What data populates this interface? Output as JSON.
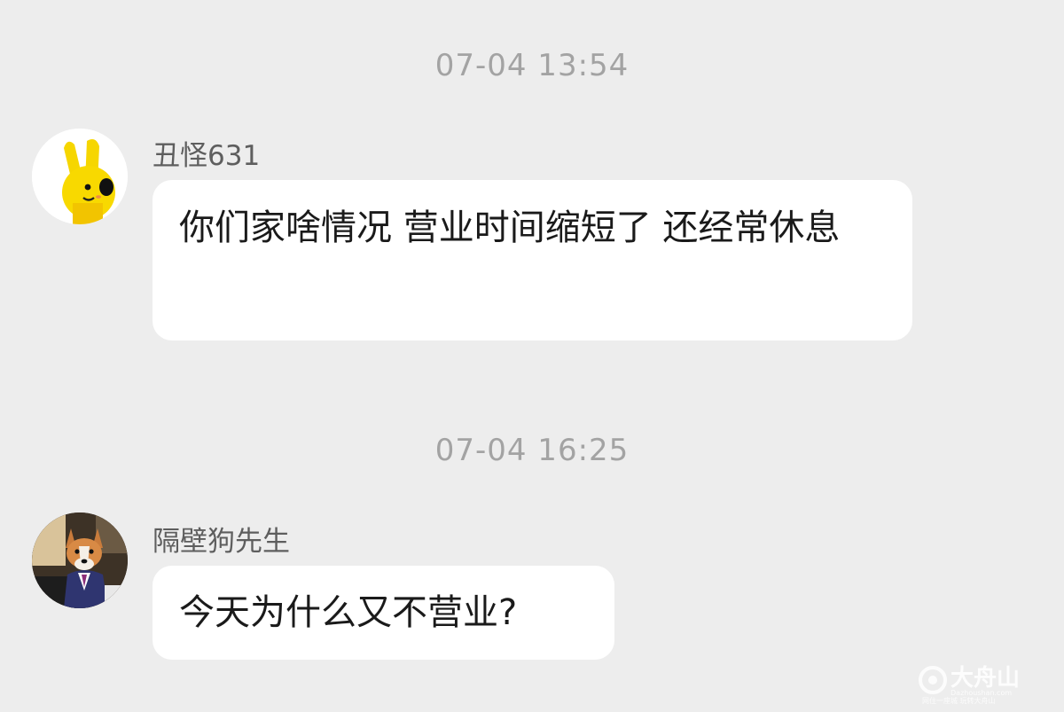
{
  "messages": [
    {
      "timestamp": "07-04 13:54",
      "sender": "丑怪631",
      "avatar": "yellow-hand-mascot-avatar",
      "text": "你们家啥情况 营业时间缩短了 还经常休息"
    },
    {
      "timestamp": "07-04 16:25",
      "sender": "隔壁狗先生",
      "avatar": "corgi-in-suit-avatar",
      "text": "今天为什么又不营业?"
    }
  ],
  "watermark": {
    "brand": "大舟山",
    "site": "Dazhoushan.com",
    "slogan": "网住一座城 玩转大舟山"
  },
  "colors": {
    "background": "#ededed",
    "bubble": "#ffffff",
    "timestamp": "#a3a3a3",
    "sender": "#5e5e5e",
    "text": "#1a1a1a"
  }
}
